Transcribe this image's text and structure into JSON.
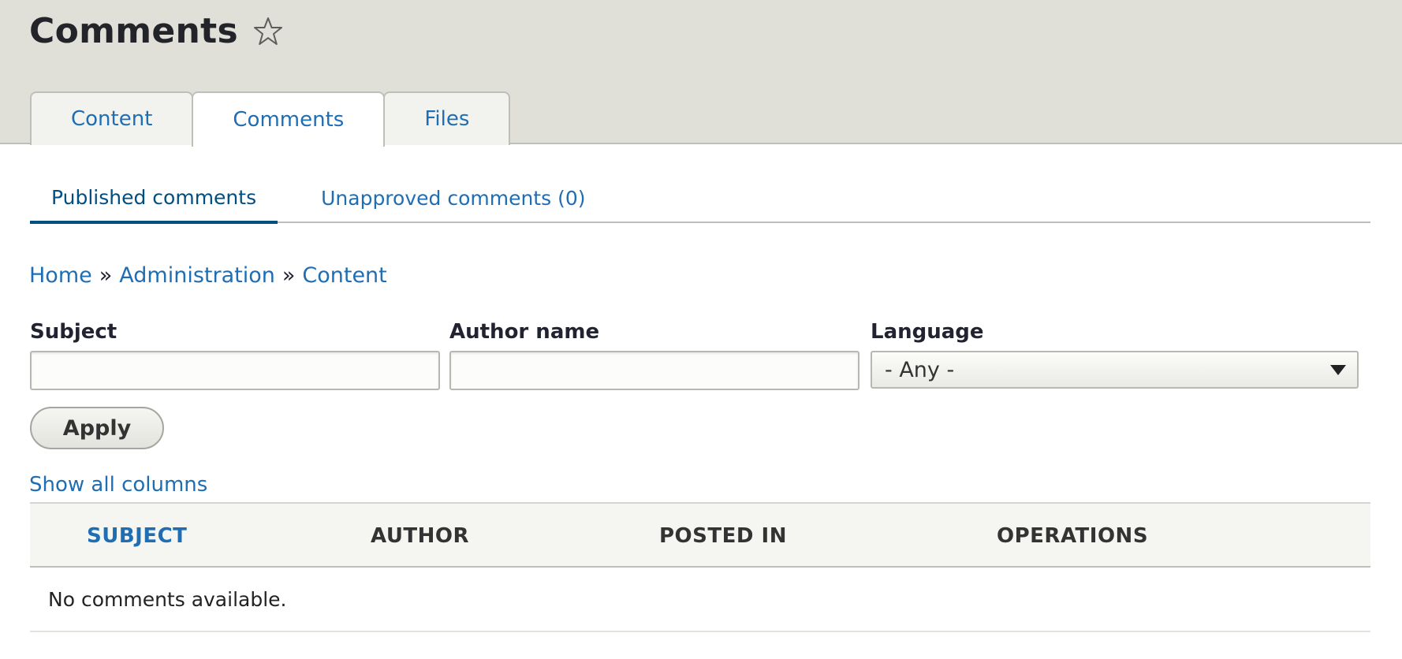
{
  "page": {
    "title": "Comments",
    "star_icon": "star-outline-icon"
  },
  "primary_tabs": [
    {
      "label": "Content",
      "active": false
    },
    {
      "label": "Comments",
      "active": true
    },
    {
      "label": "Files",
      "active": false
    }
  ],
  "secondary_tabs": [
    {
      "label": "Published comments",
      "active": true
    },
    {
      "label": "Unapproved comments (0)",
      "active": false
    }
  ],
  "breadcrumb": {
    "items": [
      "Home",
      "Administration",
      "Content"
    ],
    "separator": "»"
  },
  "filters": {
    "subject": {
      "label": "Subject",
      "value": "",
      "placeholder": ""
    },
    "author_name": {
      "label": "Author name",
      "value": "",
      "placeholder": ""
    },
    "language": {
      "label": "Language",
      "selected": "- Any -"
    },
    "apply_label": "Apply"
  },
  "show_all_columns": "Show all columns",
  "table": {
    "columns": [
      "SUBJECT",
      "AUTHOR",
      "POSTED IN",
      "OPERATIONS"
    ],
    "empty_message": "No comments available."
  },
  "colors": {
    "link": "#1f6db3",
    "active_subtab": "#004f80",
    "header_bg": "#e0e0d8"
  }
}
